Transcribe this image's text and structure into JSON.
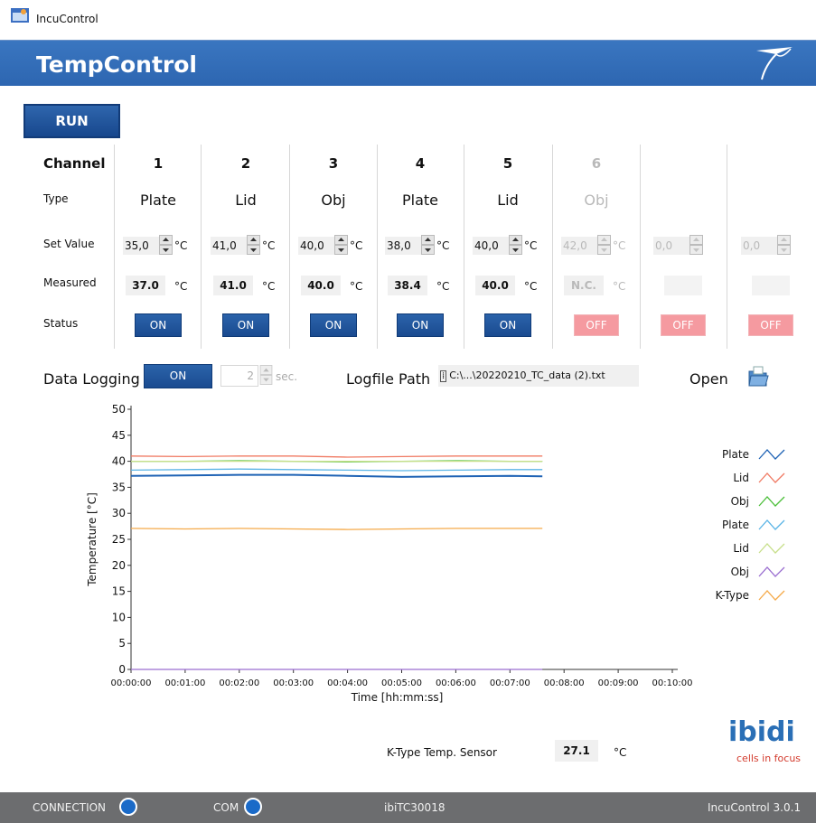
{
  "window": {
    "title": "IncuControl",
    "icon": "app-window-icon"
  },
  "header": {
    "title": "TempControl",
    "logo_icon": "ibidi-mark-icon"
  },
  "controls": {
    "run_label": "RUN"
  },
  "row_labels": {
    "channel": "Channel",
    "type": "Type",
    "set_value": "Set Value",
    "measured": "Measured",
    "status": "Status"
  },
  "channels": [
    {
      "number": "1",
      "type": "Plate",
      "set_value": "35,0",
      "unit": "°C",
      "measured": "37.0",
      "measured_unit": "°C",
      "status": "ON",
      "enabled": true
    },
    {
      "number": "2",
      "type": "Lid",
      "set_value": "41,0",
      "unit": "°C",
      "measured": "41.0",
      "measured_unit": "°C",
      "status": "ON",
      "enabled": true
    },
    {
      "number": "3",
      "type": "Obj",
      "set_value": "40,0",
      "unit": "°C",
      "measured": "40.0",
      "measured_unit": "°C",
      "status": "ON",
      "enabled": true
    },
    {
      "number": "4",
      "type": "Plate",
      "set_value": "38,0",
      "unit": "°C",
      "measured": "38.4",
      "measured_unit": "°C",
      "status": "ON",
      "enabled": true
    },
    {
      "number": "5",
      "type": "Lid",
      "set_value": "40,0",
      "unit": "°C",
      "measured": "40.0",
      "measured_unit": "°C",
      "status": "ON",
      "enabled": true
    },
    {
      "number": "6",
      "type": "Obj",
      "set_value": "42,0",
      "unit": "°C",
      "measured": "N.C.",
      "measured_unit": "°C",
      "status": "OFF",
      "enabled": false
    },
    {
      "number": "",
      "type": "",
      "set_value": "0,0",
      "unit": "",
      "measured": "",
      "measured_unit": "",
      "status": "OFF",
      "enabled": false
    },
    {
      "number": "",
      "type": "",
      "set_value": "0,0",
      "unit": "",
      "measured": "",
      "measured_unit": "",
      "status": "OFF",
      "enabled": false
    }
  ],
  "logging": {
    "label": "Data Logging",
    "toggle": "ON",
    "interval": "2",
    "interval_unit": "sec.",
    "logfile_label": "Logfile Path",
    "logfile_path": "C:\\...\\20220210_TC_data (2).txt",
    "open_label": "Open",
    "open_icon": "folder-open-icon"
  },
  "chart_data": {
    "type": "line",
    "xlabel": "Time [hh:mm:ss]",
    "ylabel": "Temperature [°C]",
    "xlim": [
      0,
      600
    ],
    "ylim": [
      0,
      50
    ],
    "x_ticks": [
      "00:00:00",
      "00:01:00",
      "00:02:00",
      "00:03:00",
      "00:04:00",
      "00:05:00",
      "00:06:00",
      "00:07:00",
      "00:08:00",
      "00:09:00",
      "00:10:00"
    ],
    "y_ticks": [
      "0",
      "5",
      "10",
      "15",
      "20",
      "25",
      "30",
      "35",
      "40",
      "45",
      "50"
    ],
    "x": [
      0,
      60,
      120,
      180,
      240,
      300,
      360,
      420,
      456
    ],
    "series": [
      {
        "name": "Plate",
        "color": "#1f63b5",
        "values": [
          37.2,
          37.3,
          37.4,
          37.4,
          37.2,
          37.0,
          37.1,
          37.2,
          37.1
        ]
      },
      {
        "name": "Lid",
        "color": "#f07a63",
        "values": [
          41.0,
          40.9,
          41.0,
          41.0,
          40.8,
          40.9,
          41.0,
          41.0,
          41.0
        ]
      },
      {
        "name": "Obj",
        "color": "#4cbf3a",
        "values": [
          40.0,
          40.0,
          40.1,
          40.0,
          39.9,
          40.0,
          40.1,
          40.0,
          40.0
        ]
      },
      {
        "name": "Plate",
        "color": "#5ab4e6",
        "values": [
          38.3,
          38.4,
          38.5,
          38.4,
          38.3,
          38.2,
          38.3,
          38.4,
          38.4
        ]
      },
      {
        "name": "Lid",
        "color": "#c7df8a",
        "values": [
          40.0,
          40.0,
          40.0,
          40.0,
          40.0,
          40.0,
          40.0,
          40.0,
          40.0
        ]
      },
      {
        "name": "Obj",
        "color": "#9a6ed0",
        "values": [
          0,
          0,
          0,
          0,
          0,
          0,
          0,
          0,
          0
        ]
      },
      {
        "name": "K-Type",
        "color": "#f5aa4a",
        "values": [
          27.1,
          27.0,
          27.1,
          27.0,
          26.9,
          27.0,
          27.1,
          27.1,
          27.1
        ]
      }
    ],
    "legend_position": "right",
    "grid": false
  },
  "sensor": {
    "label": "K-Type Temp. Sensor",
    "value": "27.1",
    "unit": "°C"
  },
  "brand": {
    "name": "ibidi",
    "tagline": "cells in focus",
    "name_color": "#2a6fb6",
    "tagline_color": "#d33a2c"
  },
  "statusbar": {
    "connection_label": "CONNECTION",
    "com_label": "COM",
    "device": "ibiTC30018",
    "version": "IncuControl 3.0.1"
  }
}
